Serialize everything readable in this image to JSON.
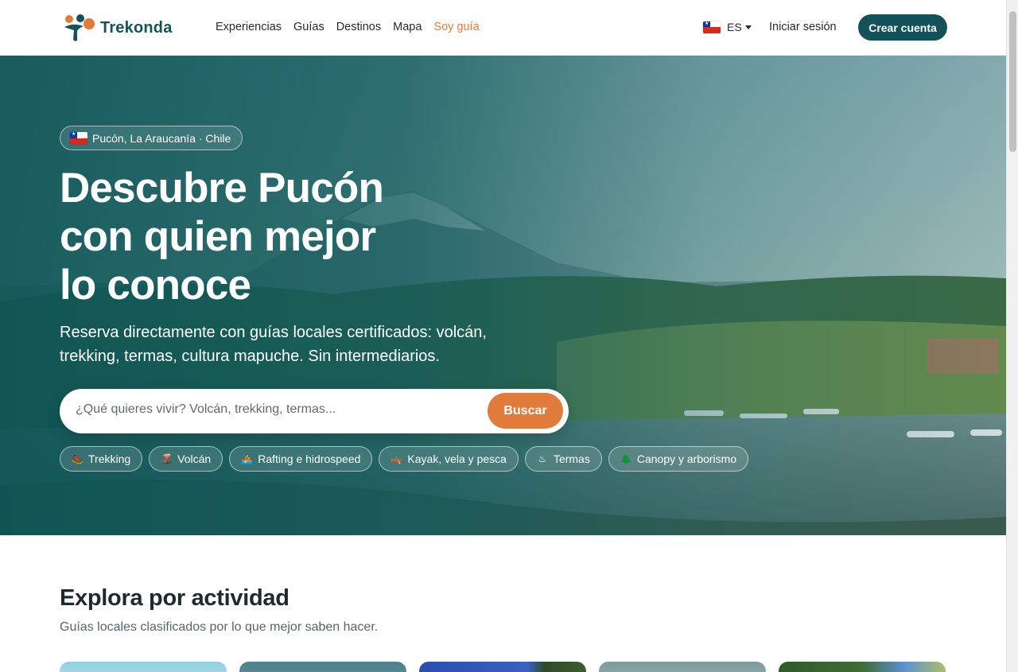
{
  "brand": {
    "name": "Trekonda"
  },
  "nav": {
    "items": [
      {
        "label": "Experiencias",
        "highlight": false
      },
      {
        "label": "Guías",
        "highlight": false
      },
      {
        "label": "Destinos",
        "highlight": false
      },
      {
        "label": "Mapa",
        "highlight": false
      },
      {
        "label": "Soy guía",
        "highlight": true
      }
    ]
  },
  "language": {
    "code": "ES",
    "flag": "chile-flag-icon"
  },
  "auth": {
    "login_label": "Iniciar sesión",
    "signup_label": "Crear cuenta"
  },
  "hero": {
    "location": "Pucón, La Araucanía · Chile",
    "title_lines": [
      "Descubre Pucón",
      "con quien mejor",
      "lo conoce"
    ],
    "subtitle": "Reserva directamente con guías locales certificados: volcán, trekking, termas, cultura mapuche. Sin intermediarios.",
    "search": {
      "placeholder": "¿Qué quieres vivir? Volcán, trekking, termas...",
      "value": "",
      "button_label": "Buscar"
    },
    "chips": [
      {
        "label": "Trekking",
        "icon": "hiking-boot-icon"
      },
      {
        "label": "Volcán",
        "icon": "volcano-icon"
      },
      {
        "label": "Rafting e hidrospeed",
        "icon": "rafting-icon"
      },
      {
        "label": "Kayak, vela y pesca",
        "icon": "kayak-icon"
      },
      {
        "label": "Termas",
        "icon": "hot-springs-icon"
      },
      {
        "label": "Canopy y arborismo",
        "icon": "canopy-icon"
      }
    ]
  },
  "explore": {
    "title": "Explora por actividad",
    "subtitle": "Guías locales clasificados por lo que mejor saben hacer."
  },
  "colors": {
    "brand_teal": "#14525a",
    "accent_orange": "#e07b3c",
    "text_dark": "#1f2a2e",
    "text_muted": "#5a656a"
  }
}
